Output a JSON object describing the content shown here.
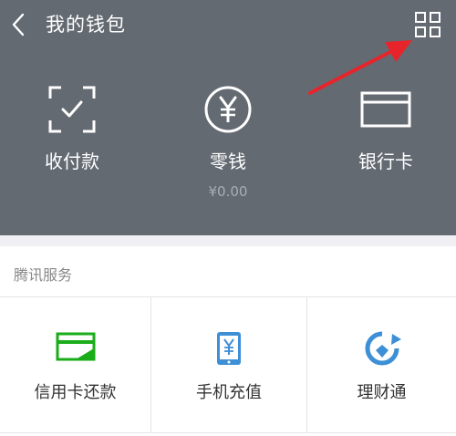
{
  "topbar": {
    "back_icon": "chevron-left-icon",
    "title": "我的钱包",
    "menu_icon": "grid-menu-icon"
  },
  "quick_actions": [
    {
      "label": "收付款",
      "icon": "scan-pay-icon"
    },
    {
      "label": "零钱",
      "icon": "yuan-coin-icon",
      "balance": "¥0.00"
    },
    {
      "label": "银行卡",
      "icon": "bank-card-icon"
    }
  ],
  "tencent_services": {
    "title": "腾讯服务",
    "items": [
      {
        "label": "信用卡还款",
        "icon": "credit-card-repay-icon",
        "color": "#1aad19"
      },
      {
        "label": "手机充值",
        "icon": "phone-recharge-icon",
        "color": "#3d8fd6"
      },
      {
        "label": "理财通",
        "icon": "wealth-icon",
        "color": "#3d8fd6"
      }
    ]
  },
  "colors": {
    "header_bg": "#646a72",
    "annotation_arrow": "#e8242b"
  }
}
